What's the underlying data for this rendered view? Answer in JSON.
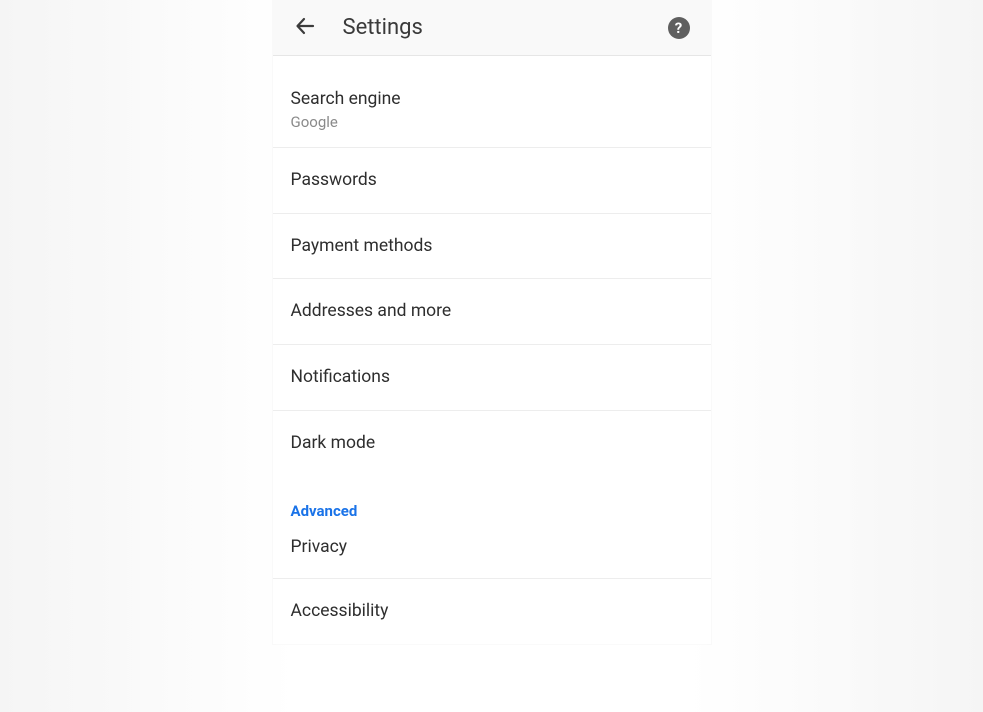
{
  "header": {
    "title": "Settings"
  },
  "basics": {
    "search_engine": {
      "title": "Search engine",
      "value": "Google"
    },
    "passwords": {
      "title": "Passwords"
    },
    "payment_methods": {
      "title": "Payment methods"
    },
    "addresses": {
      "title": "Addresses and more"
    },
    "notifications": {
      "title": "Notifications"
    },
    "dark_mode": {
      "title": "Dark mode"
    }
  },
  "advanced": {
    "section_label": "Advanced",
    "privacy": {
      "title": "Privacy"
    },
    "accessibility": {
      "title": "Accessibility"
    }
  }
}
